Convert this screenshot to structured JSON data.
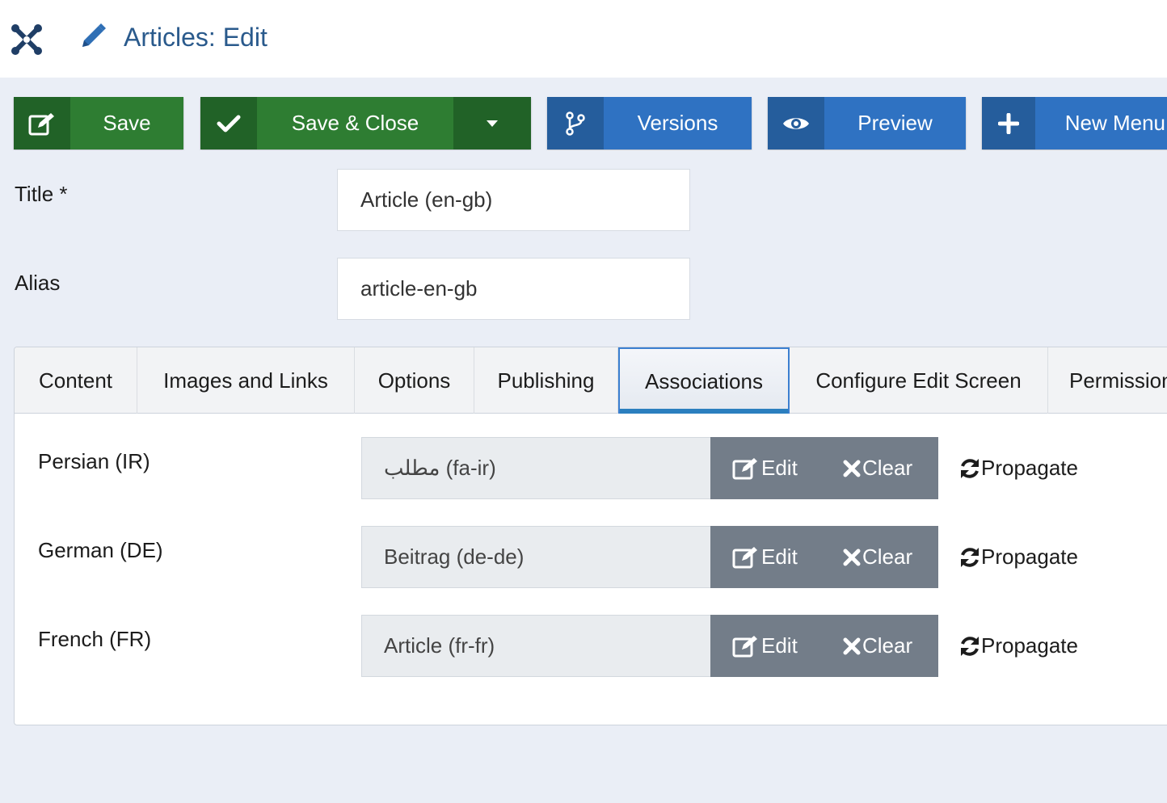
{
  "header": {
    "title": "Articles: Edit",
    "logo_icon": "joomla-logo-icon",
    "title_icon": "pencil-icon"
  },
  "toolbar": {
    "save": {
      "label": "Save",
      "icon": "edit-icon"
    },
    "save_close": {
      "label": "Save & Close",
      "icon": "check-icon",
      "dropdown_icon": "caret-down-icon"
    },
    "versions": {
      "label": "Versions",
      "icon": "branch-icon"
    },
    "preview": {
      "label": "Preview",
      "icon": "eye-icon"
    },
    "new_menu": {
      "label": "New Menu",
      "icon": "plus-icon"
    }
  },
  "form": {
    "title_label": "Title *",
    "title_value": "Article (en-gb)",
    "alias_label": "Alias",
    "alias_value": "article-en-gb"
  },
  "tabs": [
    {
      "label": "Content",
      "active": false
    },
    {
      "label": "Images and Links",
      "active": false
    },
    {
      "label": "Options",
      "active": false
    },
    {
      "label": "Publishing",
      "active": false
    },
    {
      "label": "Associations",
      "active": true
    },
    {
      "label": "Configure Edit Screen",
      "active": false
    },
    {
      "label": "Permissions",
      "active": false
    }
  ],
  "associations": [
    {
      "language": "Persian (IR)",
      "value": "مطلب (fa-ir)",
      "edit": "Edit",
      "clear": "Clear",
      "propagate": "Propagate"
    },
    {
      "language": "German (DE)",
      "value": "Beitrag (de-de)",
      "edit": "Edit",
      "clear": "Clear",
      "propagate": "Propagate"
    },
    {
      "language": "French (FR)",
      "value": "Article (fr-fr)",
      "edit": "Edit",
      "clear": "Clear",
      "propagate": "Propagate"
    }
  ],
  "colors": {
    "green": "#2e7d32",
    "green_dark": "#216227",
    "blue": "#2f72c2",
    "blue_dark": "#255d9c",
    "title_blue": "#2a5a8c",
    "button_gray": "#737d89",
    "active_tab_underline": "#2b7fbf"
  }
}
